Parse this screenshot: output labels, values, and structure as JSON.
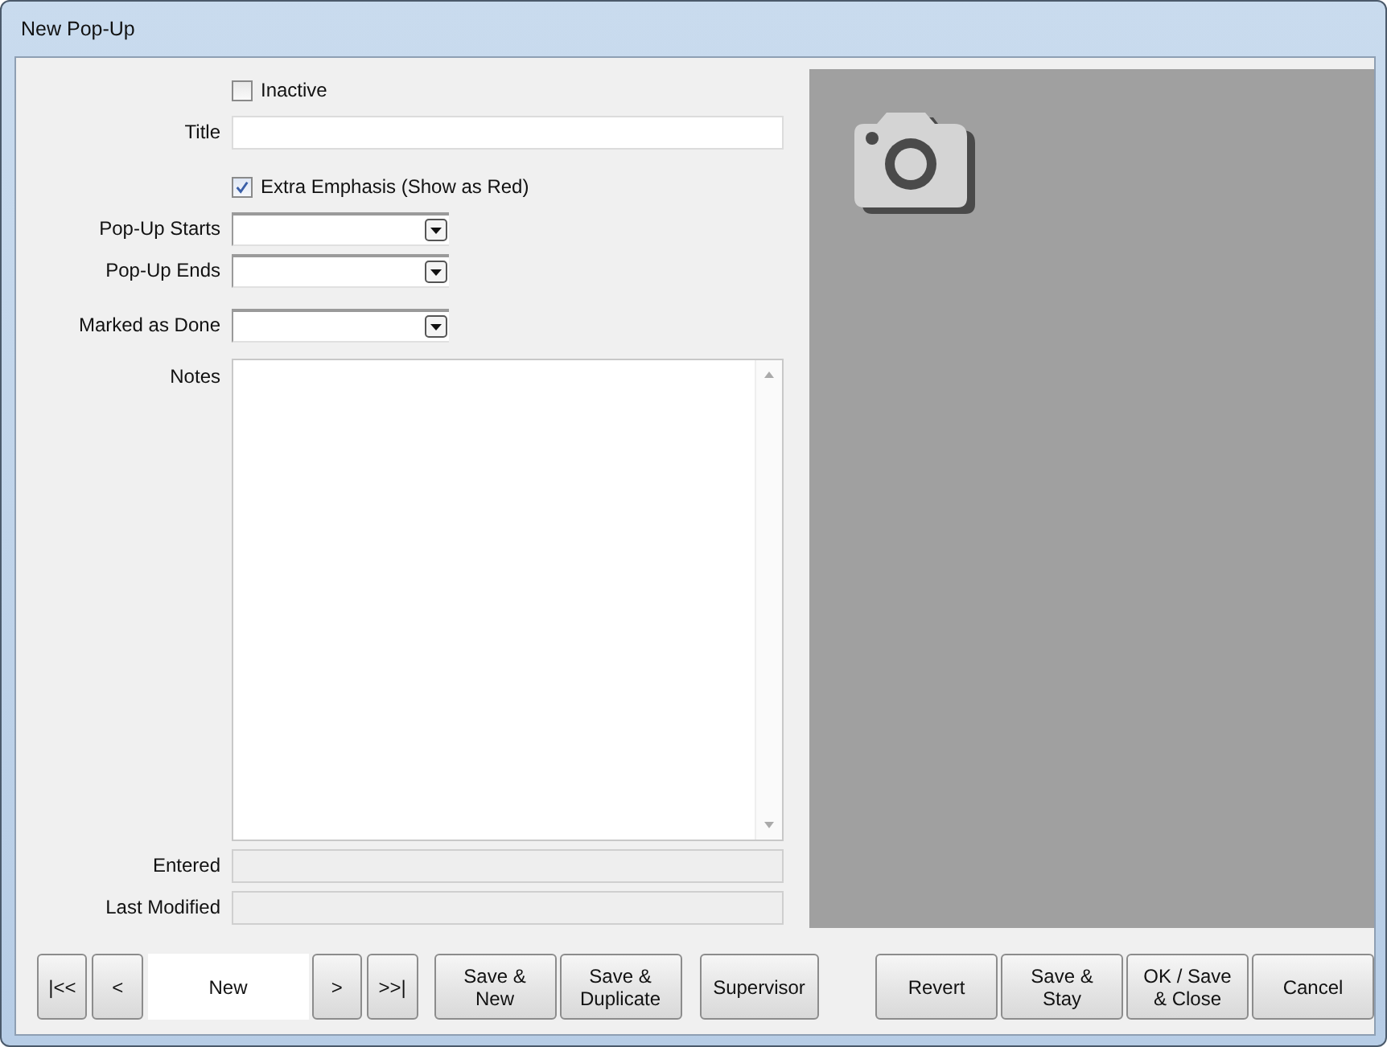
{
  "window": {
    "title": "New Pop-Up"
  },
  "form": [
    {
      "kind": "checkbox",
      "label": "Inactive",
      "checked": false
    },
    {
      "kind": "text",
      "label": "Title"
    },
    {
      "kind": "checkbox",
      "label": "Extra Emphasis (Show as Red)",
      "checked": true
    },
    {
      "kind": "dropdown",
      "label": "Pop-Up Starts"
    },
    {
      "kind": "dropdown",
      "label": "Pop-Up Ends"
    },
    {
      "kind": "dropdown",
      "label": "Marked as Done"
    },
    {
      "kind": "notes",
      "label": "Notes"
    },
    {
      "kind": "readonly",
      "label": "Entered"
    },
    {
      "kind": "readonly",
      "label": "Last Modified"
    }
  ],
  "navigation": {
    "first": "|<<",
    "previous": "<",
    "record": "New",
    "next": ">",
    "last": ">>|"
  },
  "record_buttons": [
    {
      "lines": [
        "Save &",
        "New"
      ]
    },
    {
      "lines": [
        "Save &",
        "Duplicate"
      ]
    }
  ],
  "supervisor_button": {
    "lines": [
      "Supervisor"
    ]
  },
  "dialog_buttons": [
    {
      "lines": [
        "Revert"
      ]
    },
    {
      "lines": [
        "Save &",
        "Stay"
      ]
    },
    {
      "lines": [
        "OK / Save",
        "& Close"
      ]
    },
    {
      "lines": [
        "Cancel"
      ]
    }
  ]
}
